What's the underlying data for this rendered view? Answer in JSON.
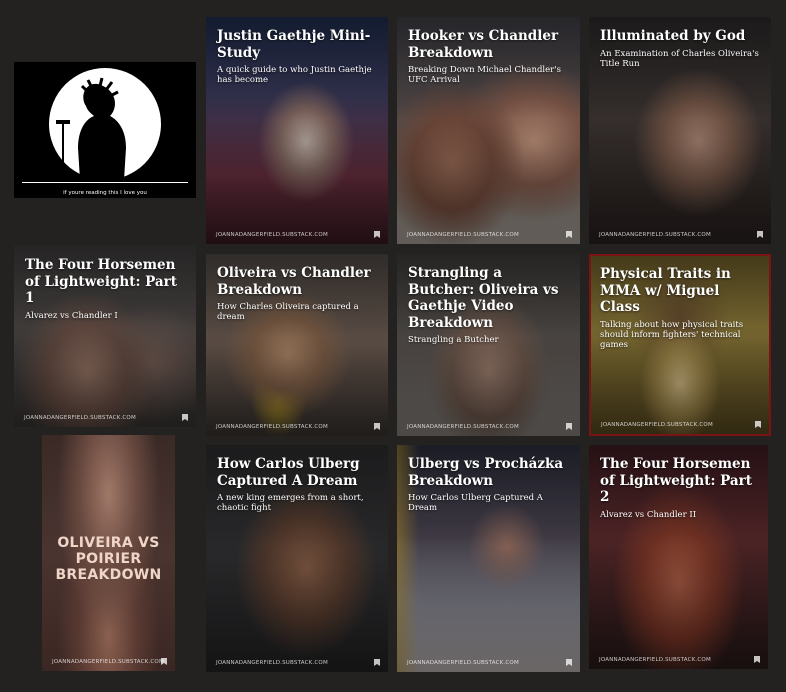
{
  "logo": {
    "caption": "if youre reading this I love you"
  },
  "site": "JOANNADANGERFIELD.SUBSTACK.COM",
  "tiles": [
    {
      "title": "Justin Gaethje Mini-Study",
      "subtitle": "A quick guide to who Justin Gaethje has become"
    },
    {
      "title": "Hooker vs Chandler Breakdown",
      "subtitle": "Breaking Down Michael Chandler's UFC Arrival"
    },
    {
      "title": "Illuminated by God",
      "subtitle": "An Examination of Charles Oliveira's Title Run"
    },
    {
      "title": "The Four Horsemen of Lightweight: Part 1",
      "subtitle": "Alvarez vs Chandler I"
    },
    {
      "title": "Oliveira vs Chandler Breakdown",
      "subtitle": "How Charles Oliveira captured a dream"
    },
    {
      "title": "Strangling a Butcher: Oliveira vs Gaethje Video Breakdown",
      "subtitle": "Strangling a Butcher"
    },
    {
      "title": "Physical Traits in MMA w/ Miguel Class",
      "subtitle": "Talking about how physical traits should inform fighters' technical games"
    },
    {
      "title": "",
      "subtitle": "",
      "overlay": "OLIVEIRA VS POIRIER BREAKDOWN"
    },
    {
      "title": "How Carlos Ulberg Captured A Dream",
      "subtitle": "A new king emerges from a short, chaotic fight"
    },
    {
      "title": "Ulberg vs Procházka Breakdown",
      "subtitle": "How Carlos Ulberg Captured A Dream"
    },
    {
      "title": "The Four Horsemen of Lightweight: Part 2",
      "subtitle": "Alvarez vs Chandler II"
    }
  ]
}
